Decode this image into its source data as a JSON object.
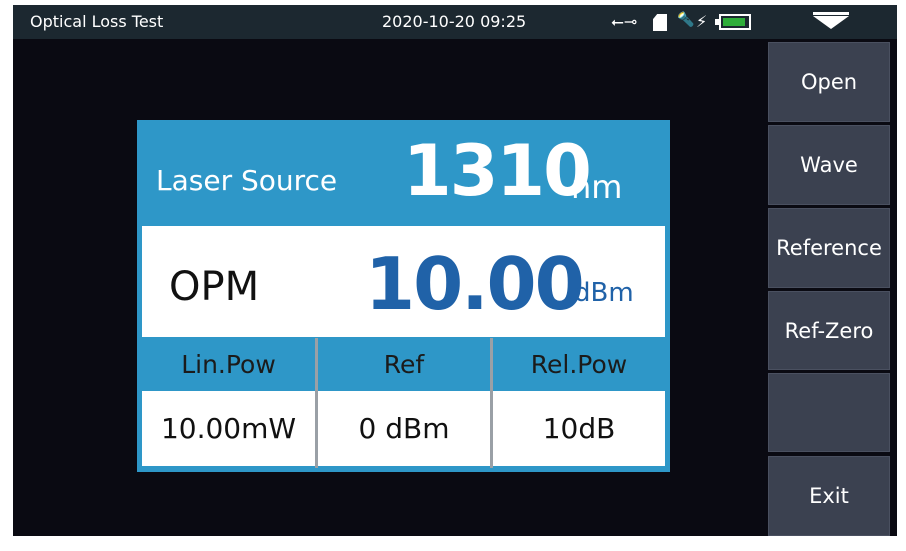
{
  "titlebar": {
    "title": "Optical Loss Test",
    "datetime": "2020-10-20 09:25",
    "battery_level": 0.9
  },
  "panel": {
    "source_label": "Laser Source",
    "wavelength": "1310",
    "wavelength_unit": "nm",
    "opm_label": "OPM",
    "power": "10.00",
    "power_unit": "dBm",
    "columns": [
      {
        "label": "Lin.Pow",
        "value": "10.00mW"
      },
      {
        "label": "Ref",
        "value": "0 dBm"
      },
      {
        "label": "Rel.Pow",
        "value": "10dB"
      }
    ]
  },
  "sidebar": {
    "buttons": [
      "Open",
      "Wave",
      "Reference",
      "Ref-Zero",
      "",
      "Exit"
    ]
  },
  "colors": {
    "accent": "#2e97c8",
    "value_blue": "#2062a8",
    "button": "#3b4150"
  }
}
